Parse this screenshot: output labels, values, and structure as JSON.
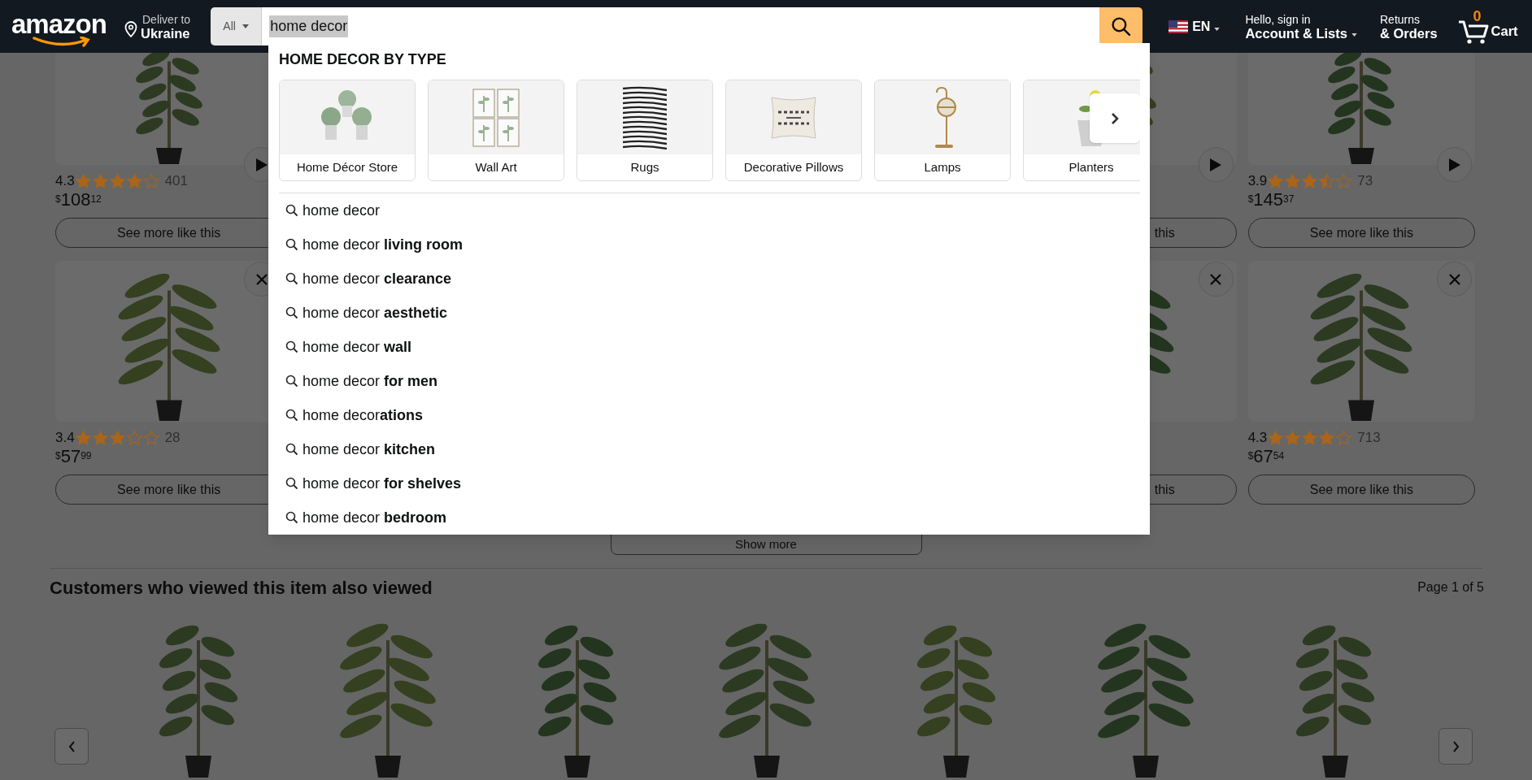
{
  "header": {
    "logo": "amazon",
    "deliver_to": {
      "label": "Deliver to",
      "location": "Ukraine"
    },
    "search": {
      "category": "All",
      "value": "home decor"
    },
    "language": "EN",
    "account": {
      "greeting": "Hello, sign in",
      "label": "Account & Lists"
    },
    "orders": {
      "label": "Returns",
      "sublabel": "& Orders"
    },
    "cart": {
      "count": "0",
      "label": "Cart"
    }
  },
  "search_dropdown": {
    "heading": "HOME DECOR BY TYPE",
    "categories": [
      {
        "label": "Home Décor Store"
      },
      {
        "label": "Wall Art"
      },
      {
        "label": "Rugs"
      },
      {
        "label": "Decorative Pillows"
      },
      {
        "label": "Lamps"
      },
      {
        "label": "Planters"
      }
    ],
    "suggestions": [
      "home decor",
      "home decor **living room**",
      "home decor **clearance**",
      "home decor **aesthetic**",
      "home decor **wall**",
      "home decor **for men**",
      "home decor**ations**",
      "home decor **kitchen**",
      "home decor **for shelves**",
      "home decor **bedroom**"
    ]
  },
  "product_grid": {
    "rows": [
      {
        "cards": [
          {
            "kind": "full",
            "overlay": {
              "kind": "play"
            },
            "rating": "4.3",
            "stars": 4,
            "reviews": "401",
            "price": {
              "currency": "$",
              "whole": "108",
              "fraction": "12"
            },
            "button": "See more like this"
          },
          {
            "kind": "partial",
            "overlay": {
              "kind": "play"
            },
            "button": "this"
          },
          {
            "kind": "full",
            "overlay": {
              "kind": "play"
            },
            "rating": "3.9",
            "stars": 3.5,
            "reviews": "73",
            "price": {
              "currency": "$",
              "whole": "145",
              "fraction": "37"
            },
            "button": "See more like this"
          }
        ]
      },
      {
        "cards": [
          {
            "kind": "full",
            "overlay": {
              "kind": "close"
            },
            "rating": "3.4",
            "stars": 3,
            "reviews": "28",
            "price": {
              "currency": "$",
              "whole": "57",
              "fraction": "99"
            },
            "button": "See more like this"
          },
          {
            "kind": "partial",
            "overlay": {
              "kind": "close"
            },
            "button": "this"
          },
          {
            "kind": "full",
            "overlay": {
              "kind": "close"
            },
            "rating": "4.3",
            "stars": 4,
            "reviews": "713",
            "price": {
              "currency": "$",
              "whole": "67",
              "fraction": "54"
            },
            "button": "See more like this"
          }
        ]
      }
    ]
  },
  "show_more": "Show more",
  "also_viewed": {
    "title": "Customers who viewed this item also viewed",
    "page_indicator": "Page 1 of 5"
  }
}
